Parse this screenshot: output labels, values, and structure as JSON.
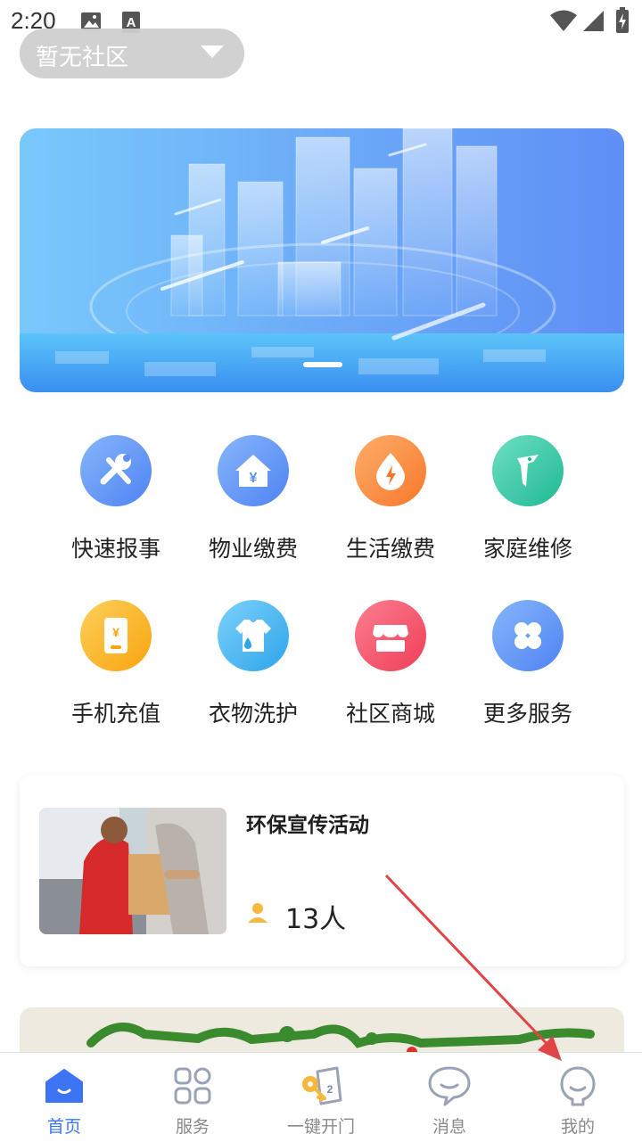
{
  "status_bar": {
    "time": "2:20"
  },
  "community": {
    "label": "暂无社区"
  },
  "services": [
    {
      "label": "快速报事",
      "icon": "wrench-icon",
      "color": "#5b8ff6"
    },
    {
      "label": "物业缴费",
      "icon": "house-yen-icon",
      "color": "#5b8ff6"
    },
    {
      "label": "生活缴费",
      "icon": "drop-bolt-icon",
      "color": "#fb8a3c"
    },
    {
      "label": "家庭维修",
      "icon": "woodpecker-icon",
      "color": "#35c9a8"
    },
    {
      "label": "手机充值",
      "icon": "phone-yen-icon",
      "color": "#fbb323"
    },
    {
      "label": "衣物洗护",
      "icon": "shirt-icon",
      "color": "#47b5ee"
    },
    {
      "label": "社区商城",
      "icon": "store-icon",
      "color": "#f5566b"
    },
    {
      "label": "更多服务",
      "icon": "grid-icon",
      "color": "#5b8ff6"
    }
  ],
  "activity": {
    "title": "环保宣传活动",
    "count": "13人"
  },
  "tabs": [
    {
      "label": "首页",
      "icon": "home-icon",
      "active": true
    },
    {
      "label": "服务",
      "icon": "apps-icon",
      "active": false
    },
    {
      "label": "一键开门",
      "icon": "key-icon",
      "active": false
    },
    {
      "label": "消息",
      "icon": "message-icon",
      "active": false
    },
    {
      "label": "我的",
      "icon": "profile-icon",
      "active": false
    }
  ],
  "colors": {
    "accent": "#3d74f4",
    "annotation_arrow": "#e04545"
  }
}
